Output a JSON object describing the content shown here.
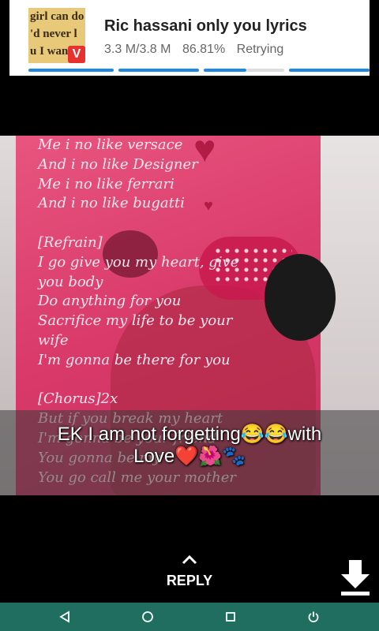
{
  "notification": {
    "thumbnail_text": [
      "girl can do",
      "'d never l",
      "u I want, w"
    ],
    "badge_letter": "V",
    "title": "Ric hassani only you lyrics",
    "size": "3.3 M/3.8 M",
    "percent": "86.81%",
    "status": "Retrying",
    "progress": 0.8681
  },
  "status_image": {
    "lyrics": "Me i no like versace\nAnd i no like Designer\nMe i no like ferrari\nAnd i no like bugatti\n\n[Refrain]\nI go give you my heart, give\nyou body\nDo anything for you\nSacrifice my life to be your\nwife\nI'm gonna be there for you\n\n[Chorus]2x\nBut if you break my heart\nI'm gonna be your friend\nYou gonna be my\nYou go call me your mother",
    "caption_line1": "EK I am not forgetting😂😂with",
    "caption_line2": "Love❤️🌺🐾"
  },
  "reply": {
    "label": "REPLY"
  },
  "colors": {
    "accent": "#1e88e5",
    "navbar": "#1f6e5f",
    "card": "#d93a6a"
  },
  "icons": {
    "reply": "chevron-up-icon",
    "download": "download-icon",
    "back": "back-triangle-icon",
    "home": "home-circle-icon",
    "recents": "recents-square-icon",
    "power": "power-icon"
  }
}
